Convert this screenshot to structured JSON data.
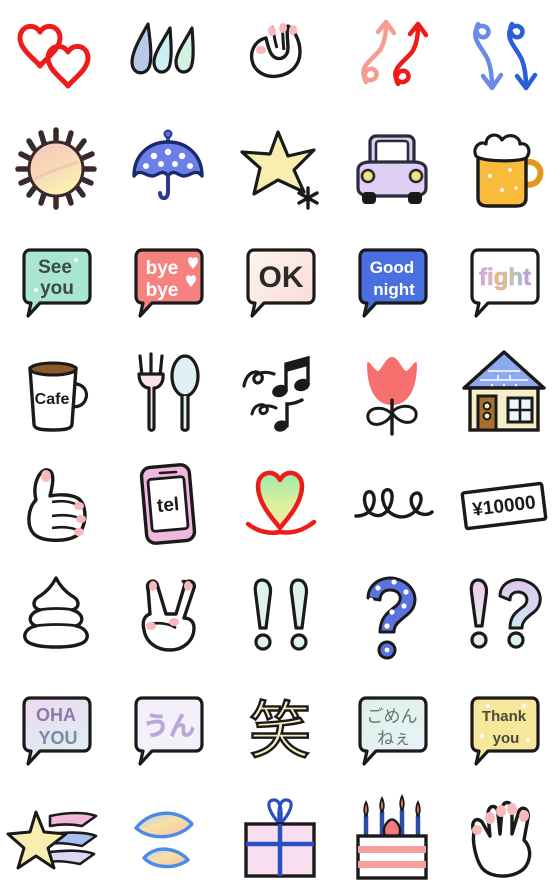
{
  "sheet": {
    "title": "Hand-drawn Pastel Emoji Sticker Sheet",
    "background_color": "#ffffff",
    "columns": 5,
    "rows": 8,
    "cell_size_px": 112,
    "ink_color": "#1a1a1a",
    "style": "hand-drawn doodle, pastel fills, black crayon outline"
  },
  "palette": {
    "ink": "#1a1a1a",
    "red": "#ee1b1b",
    "salmon": "#f79c92",
    "blue": "#2b5fd9",
    "royal_blue": "#4a6fe0",
    "mint": "#a8e6cf",
    "pink": "#f77f87",
    "cream_pink": "#fbe3e0",
    "lavender": "#d6c7f0",
    "yellow": "#f7e9a0",
    "amber": "#f5b23c",
    "white": "#ffffff",
    "pale_mint": "#dff3ee",
    "pale_blue": "#cfe6f7",
    "periwinkle": "#5a72e0",
    "brown": "#8a5a2b",
    "tan": "#f2e7c9"
  },
  "stickers": [
    {
      "row": 1,
      "col": 1,
      "name": "two-hearts",
      "label": "Two Hearts",
      "text": "",
      "colors": [
        "#ee1b1b"
      ]
    },
    {
      "row": 1,
      "col": 2,
      "name": "raindrops",
      "label": "Three Raindrops",
      "text": "",
      "colors": [
        "#b9c9e8",
        "#cdeef2",
        "#d4f0de"
      ]
    },
    {
      "row": 1,
      "col": 3,
      "name": "ok-hand",
      "label": "OK Hand Sign",
      "text": "",
      "colors": [
        "#ffffff",
        "#f7b9bc"
      ]
    },
    {
      "row": 1,
      "col": 4,
      "name": "up-arrows",
      "label": "Two Curly Up Arrows",
      "text": "",
      "colors": [
        "#f79c92",
        "#ee1b1b"
      ]
    },
    {
      "row": 1,
      "col": 5,
      "name": "down-arrows",
      "label": "Two Curly Down Arrows",
      "text": "",
      "colors": [
        "#6a8ae8",
        "#2b5fd9"
      ]
    },
    {
      "row": 2,
      "col": 1,
      "name": "sun",
      "label": "Sun",
      "text": "",
      "colors": [
        "#f7c6c0",
        "#f7efb0"
      ]
    },
    {
      "row": 2,
      "col": 2,
      "name": "umbrella",
      "label": "Polka Dot Umbrella",
      "text": "",
      "colors": [
        "#6a7fe8",
        "#ffffff"
      ]
    },
    {
      "row": 2,
      "col": 3,
      "name": "shooting-star-sparkle",
      "label": "Star with Sparkle",
      "text": "",
      "colors": [
        "#f8eeb0"
      ]
    },
    {
      "row": 2,
      "col": 4,
      "name": "car",
      "label": "Car Front View",
      "text": "",
      "colors": [
        "#ddd0f2",
        "#ffffff",
        "#f3e47a"
      ]
    },
    {
      "row": 2,
      "col": 5,
      "name": "beer-mug",
      "label": "Beer Mug",
      "text": "",
      "colors": [
        "#f9bb3c",
        "#ffffff"
      ]
    },
    {
      "row": 3,
      "col": 1,
      "name": "bubble-see-you",
      "label": "See You Speech Bubble",
      "text": "See you",
      "text_lines": [
        "See",
        "you"
      ],
      "bubble_color": "#a8e6cf",
      "text_color": "#3b4a44"
    },
    {
      "row": 3,
      "col": 2,
      "name": "bubble-bye-bye",
      "label": "Bye Bye Speech Bubble",
      "text": "bye bye",
      "text_lines": [
        "bye",
        "bye"
      ],
      "bubble_color": "#f6827f",
      "text_color": "#ffffff"
    },
    {
      "row": 3,
      "col": 3,
      "name": "bubble-ok",
      "label": "OK Speech Bubble",
      "text": "OK",
      "text_lines": [
        "OK"
      ],
      "bubble_color": "#fbe3e0",
      "text_color": "#2b2b2b"
    },
    {
      "row": 3,
      "col": 4,
      "name": "bubble-good-night",
      "label": "Good Night Speech Bubble",
      "text": "Good night",
      "text_lines": [
        "Good",
        "night"
      ],
      "bubble_color": "#4a6fe0",
      "text_color": "#ffffff"
    },
    {
      "row": 3,
      "col": 5,
      "name": "bubble-fight",
      "label": "Fight Speech Bubble",
      "text": "fight",
      "text_lines": [
        "fight"
      ],
      "bubble_color": "#ffffff",
      "text_color": "#c87fc8"
    },
    {
      "row": 4,
      "col": 1,
      "name": "cafe-mug",
      "label": "Cafe Mug",
      "text": "Cafe",
      "colors": [
        "#ffffff",
        "#8a5a2b"
      ]
    },
    {
      "row": 4,
      "col": 2,
      "name": "fork-and-spoon",
      "label": "Fork and Spoon",
      "text": "",
      "colors": [
        "#fae2ea",
        "#dff0f2"
      ]
    },
    {
      "row": 4,
      "col": 3,
      "name": "music-notes",
      "label": "Music Notes",
      "text": "",
      "colors": [
        "#1a1a1a"
      ]
    },
    {
      "row": 4,
      "col": 4,
      "name": "tulip",
      "label": "Tulip Flower",
      "text": "",
      "colors": [
        "#f76f6f",
        "#ffffff"
      ]
    },
    {
      "row": 4,
      "col": 5,
      "name": "house",
      "label": "House",
      "text": "",
      "colors": [
        "#8fa9f0",
        "#f6edc9",
        "#8a5a2b"
      ]
    },
    {
      "row": 5,
      "col": 1,
      "name": "thumbs-up",
      "label": "Thumbs Up",
      "text": "",
      "colors": [
        "#ffffff",
        "#f7b9bc"
      ]
    },
    {
      "row": 5,
      "col": 2,
      "name": "phone-tel",
      "label": "Phone with tel",
      "text": "tel",
      "colors": [
        "#f0b8dd",
        "#ffffff"
      ]
    },
    {
      "row": 5,
      "col": 3,
      "name": "gradient-heart",
      "label": "Gradient Heart",
      "text": "",
      "colors": [
        "#ee1b1b",
        "#9fe8a8",
        "#f5ec9a"
      ]
    },
    {
      "row": 5,
      "col": 4,
      "name": "loop-squiggle",
      "label": "Loop Squiggle",
      "text": "",
      "colors": [
        "#ffffff"
      ]
    },
    {
      "row": 5,
      "col": 5,
      "name": "banknote",
      "label": "Ten Thousand Yen Note",
      "text": "¥10000",
      "colors": [
        "#ffffff"
      ]
    },
    {
      "row": 6,
      "col": 1,
      "name": "soft-swirl",
      "label": "Soft Swirl",
      "text": "",
      "colors": [
        "#ffffff"
      ]
    },
    {
      "row": 6,
      "col": 2,
      "name": "peace-sign",
      "label": "Peace Sign Hand",
      "text": "",
      "colors": [
        "#ffffff",
        "#f7b9bc"
      ]
    },
    {
      "row": 6,
      "col": 3,
      "name": "double-exclamation",
      "label": "Double Exclamation",
      "text": "!!",
      "colors": [
        "#dff3ee"
      ]
    },
    {
      "row": 6,
      "col": 4,
      "name": "question-mark",
      "label": "Polka Dot Question Mark",
      "text": "?",
      "colors": [
        "#5a72e0",
        "#ffffff"
      ]
    },
    {
      "row": 6,
      "col": 5,
      "name": "exclamation-question",
      "label": "Exclamation Question",
      "text": "!?",
      "colors": [
        "#e0c8ea",
        "#cfe6f7"
      ]
    },
    {
      "row": 7,
      "col": 1,
      "name": "bubble-oha-you",
      "label": "OHA YOU Speech Bubble",
      "text": "OHA YOU",
      "text_lines": [
        "OHA",
        "YOU"
      ],
      "bubble_color": "#ead8f0",
      "text_color": "#7a6f9c"
    },
    {
      "row": 7,
      "col": 2,
      "name": "bubble-un",
      "label": "Un Speech Bubble",
      "text": "うん",
      "text_lines": [
        "うん"
      ],
      "bubble_color": "#f4f0fa",
      "text_color": "#b8a8d8"
    },
    {
      "row": 7,
      "col": 3,
      "name": "kanji-warau",
      "label": "Laugh Kanji",
      "text": "笑",
      "text_color": "#f7efc0"
    },
    {
      "row": 7,
      "col": 4,
      "name": "bubble-gomen-ne",
      "label": "Gomen Ne Speech Bubble",
      "text": "ごめんねぇ",
      "text_lines": [
        "ごめん",
        "ねぇ"
      ],
      "bubble_color": "#dff0ea",
      "text_color": "#5a7a7a"
    },
    {
      "row": 7,
      "col": 5,
      "name": "bubble-thank-you",
      "label": "Thank You Speech Bubble",
      "text": "Thank you",
      "text_lines": [
        "Thank",
        "you"
      ],
      "bubble_color": "#f7e79a",
      "text_color": "#4a4a3a"
    },
    {
      "row": 8,
      "col": 1,
      "name": "shooting-star-trail",
      "label": "Shooting Star with Trail",
      "text": "",
      "colors": [
        "#f8eeb0",
        "#f2b8d8",
        "#a8c0f0"
      ]
    },
    {
      "row": 8,
      "col": 2,
      "name": "petals",
      "label": "Two Petals",
      "text": "",
      "colors": [
        "#4a8ae8",
        "#f8d8a0"
      ]
    },
    {
      "row": 8,
      "col": 3,
      "name": "gift-box",
      "label": "Gift Box",
      "text": "",
      "colors": [
        "#f8dff0",
        "#2b4fc0"
      ]
    },
    {
      "row": 8,
      "col": 4,
      "name": "birthday-cake",
      "label": "Birthday Cake",
      "text": "",
      "colors": [
        "#ffffff",
        "#f27a7a",
        "#2b4fa0"
      ]
    },
    {
      "row": 8,
      "col": 5,
      "name": "open-palm",
      "label": "Open Palm Hand",
      "text": "",
      "colors": [
        "#ffffff",
        "#f7b9bc"
      ]
    }
  ]
}
